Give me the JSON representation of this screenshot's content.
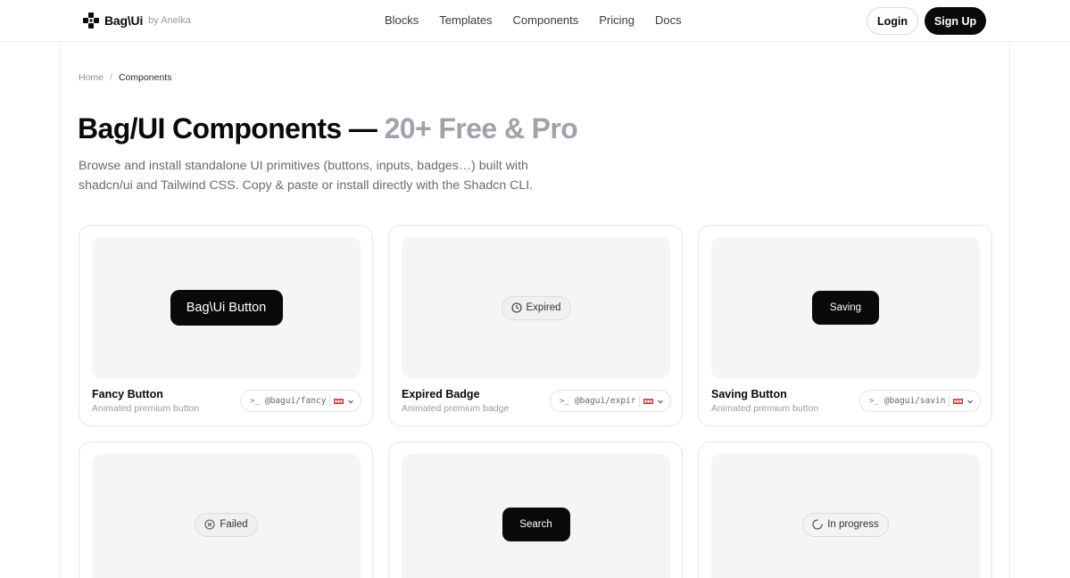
{
  "brand": {
    "name": "Bag\\Ui",
    "by": "by Anelka"
  },
  "nav": {
    "items": [
      "Blocks",
      "Templates",
      "Components",
      "Pricing",
      "Docs"
    ]
  },
  "auth": {
    "login": "Login",
    "signup": "Sign Up"
  },
  "breadcrumb": {
    "home": "Home",
    "sep": "/",
    "current": "Components"
  },
  "hero": {
    "title_main": "Bag/UI Components — ",
    "title_muted": "20+ Free & Pro",
    "description": "Browse and install standalone UI primitives (buttons, inputs, badges…) built with shadcn/ui and Tailwind CSS. Copy & paste or install directly with the Shadcn CLI."
  },
  "cli": {
    "prompt": ">_"
  },
  "cards": [
    {
      "title": "Fancy Button",
      "subtitle": "Animated premium button",
      "cli": "@bagui/fancy-button",
      "demo": "Bag\\Ui Button"
    },
    {
      "title": "Expired Badge",
      "subtitle": "Animated premium badge",
      "cli": "@bagui/expired-badge",
      "demo": "Expired",
      "demo_icon": "clock-icon"
    },
    {
      "title": "Saving Button",
      "subtitle": "Animated premium button",
      "cli": "@bagui/saving-button",
      "demo": "Saving"
    },
    {
      "demo": "Failed",
      "demo_icon": "x-circle-icon"
    },
    {
      "demo": "Search"
    },
    {
      "demo": "In progress",
      "demo_icon": "spinner-icon"
    }
  ],
  "colors": {
    "accent": "#0a0a0a",
    "muted_title": "#a0a3ab",
    "preview_bg": "#f5f5f5",
    "border": "#e5e5e5",
    "pm_badge": "#cb3837"
  }
}
